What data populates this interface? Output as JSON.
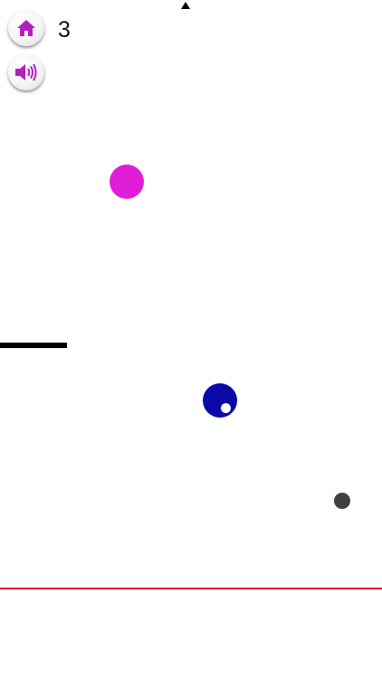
{
  "hud": {
    "home_icon": "home-icon",
    "sound_icon": "speaker-icon",
    "score": "3"
  },
  "colors": {
    "icon_magenta": "#b41fc0",
    "ball_magenta": "#e01ed8",
    "player_blue": "#0a0aa8",
    "obstacle_gray": "#404040",
    "danger_line": "#e4202a"
  }
}
